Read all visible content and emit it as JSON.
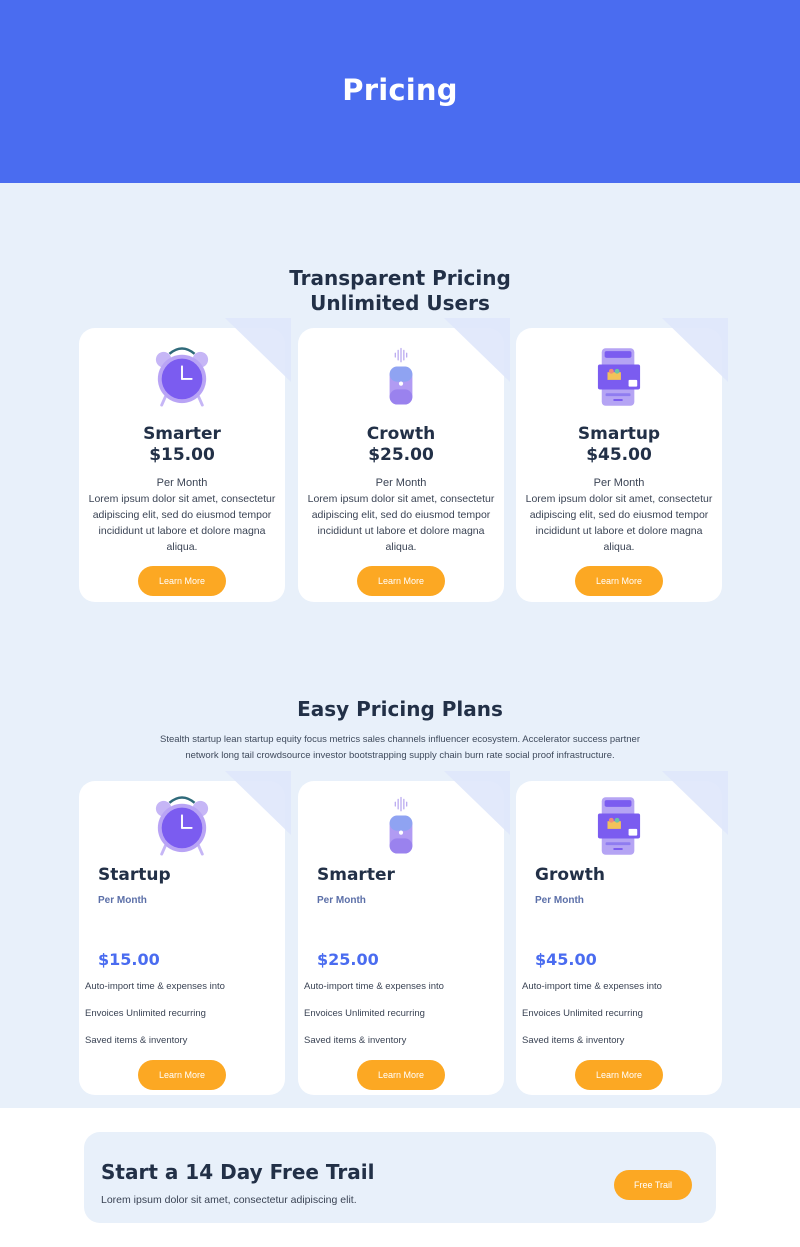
{
  "hero": {
    "title": "Pricing"
  },
  "section1": {
    "title_line1": "Transparent Pricing",
    "title_line2": "Unlimited Users",
    "cards": [
      {
        "icon": "alarm-clock-icon",
        "name": "Smarter",
        "price": "$15.00",
        "period": "Per Month",
        "description": "Lorem ipsum dolor sit amet, consectetur adipiscing elit, sed do eiusmod tempor incididunt ut labore et dolore magna aliqua.",
        "button": "Learn More"
      },
      {
        "icon": "smart-speaker-icon",
        "name": "Crowth",
        "price": "$25.00",
        "period": "Per Month",
        "description": "Lorem ipsum dolor sit amet, consectetur adipiscing elit, sed do eiusmod tempor incididunt ut labore et dolore magna aliqua.",
        "button": "Learn More"
      },
      {
        "icon": "tablet-device-icon",
        "name": "Smartup",
        "price": "$45.00",
        "period": "Per Month",
        "description": "Lorem ipsum dolor sit amet, consectetur adipiscing elit, sed do eiusmod tempor incididunt ut labore et dolore magna aliqua.",
        "button": "Learn More"
      }
    ]
  },
  "section2": {
    "title": "Easy Pricing Plans",
    "description": "Stealth startup lean startup equity focus metrics sales channels influencer ecosystem. Accelerator success partner network long tail crowdsource investor bootstrapping supply chain burn rate social proof infrastructure.",
    "cards": [
      {
        "icon": "alarm-clock-icon",
        "name": "Startup",
        "period": "Per Month",
        "price": "$15.00",
        "features": [
          "Auto-import time & expenses into",
          "Envoices Unlimited recurring",
          "Saved items & inventory"
        ],
        "button": "Learn More"
      },
      {
        "icon": "smart-speaker-icon",
        "name": "Smarter",
        "period": "Per Month",
        "price": "$25.00",
        "features": [
          "Auto-import time & expenses into",
          "Envoices Unlimited recurring",
          "Saved items & inventory"
        ],
        "button": "Learn More"
      },
      {
        "icon": "tablet-device-icon",
        "name": "Growth",
        "period": "Per Month",
        "price": "$45.00",
        "features": [
          "Auto-import time & expenses into",
          "Envoices Unlimited recurring",
          "Saved items & inventory"
        ],
        "button": "Learn More"
      }
    ]
  },
  "trial": {
    "title": "Start a 14 Day Free Trail",
    "description": "Lorem ipsum dolor sit amet, consectetur adipiscing elit.",
    "button": "Free Trail"
  },
  "colors": {
    "hero": "#4a6cf0",
    "section_background": "#e8f0fa",
    "button": "#fca823",
    "price_accent": "#4a6cf0",
    "heading": "#223047"
  }
}
